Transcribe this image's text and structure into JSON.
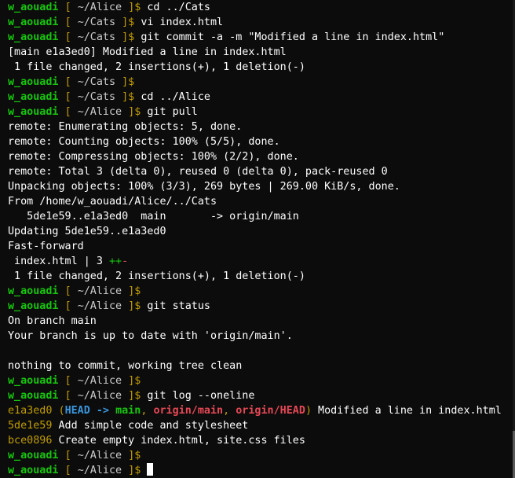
{
  "prompt": {
    "user": "w_aouadi",
    "open_bracket": "[",
    "close_bracket": "]$"
  },
  "lines": [
    {
      "type": "prompt",
      "dir": "~/Alice",
      "cmd": "cd ../Cats"
    },
    {
      "type": "prompt",
      "dir": "~/Cats",
      "cmd": "vi index.html"
    },
    {
      "type": "prompt",
      "dir": "~/Cats",
      "cmd": "git commit -a -m \"Modified a line in index.html\""
    },
    {
      "type": "output",
      "text": "[main e1a3ed0] Modified a line in index.html"
    },
    {
      "type": "output",
      "text": " 1 file changed, 2 insertions(+), 1 deletion(-)"
    },
    {
      "type": "prompt",
      "dir": "~/Cats",
      "cmd": ""
    },
    {
      "type": "prompt",
      "dir": "~/Cats",
      "cmd": "cd ../Alice"
    },
    {
      "type": "prompt",
      "dir": "~/Alice",
      "cmd": "git pull"
    },
    {
      "type": "output",
      "text": "remote: Enumerating objects: 5, done."
    },
    {
      "type": "output",
      "text": "remote: Counting objects: 100% (5/5), done."
    },
    {
      "type": "output",
      "text": "remote: Compressing objects: 100% (2/2), done."
    },
    {
      "type": "output",
      "text": "remote: Total 3 (delta 0), reused 0 (delta 0), pack-reused 0"
    },
    {
      "type": "output",
      "text": "Unpacking objects: 100% (3/3), 269 bytes | 269.00 KiB/s, done."
    },
    {
      "type": "output",
      "text": "From /home/w_aouadi/Alice/../Cats"
    },
    {
      "type": "output",
      "text": "   5de1e59..e1a3ed0  main       -> origin/main"
    },
    {
      "type": "output",
      "text": "Updating 5de1e59..e1a3ed0"
    },
    {
      "type": "output",
      "text": "Fast-forward"
    },
    {
      "type": "diffstat",
      "text": " index.html | 3 ",
      "plus": "++",
      "minus": "-"
    },
    {
      "type": "output",
      "text": " 1 file changed, 2 insertions(+), 1 deletion(-)"
    },
    {
      "type": "prompt",
      "dir": "~/Alice",
      "cmd": ""
    },
    {
      "type": "prompt",
      "dir": "~/Alice",
      "cmd": "git status"
    },
    {
      "type": "output",
      "text": "On branch main"
    },
    {
      "type": "output",
      "text": "Your branch is up to date with 'origin/main'."
    },
    {
      "type": "output",
      "text": ""
    },
    {
      "type": "output",
      "text": "nothing to commit, working tree clean"
    },
    {
      "type": "prompt",
      "dir": "~/Alice",
      "cmd": ""
    },
    {
      "type": "prompt",
      "dir": "~/Alice",
      "cmd": "git log --oneline"
    },
    {
      "type": "log",
      "hash": "e1a3ed0",
      "decorated": true,
      "msg": " Modified a line in index.html"
    },
    {
      "type": "log",
      "hash": "5de1e59",
      "decorated": false,
      "msg": " Add simple code and stylesheet"
    },
    {
      "type": "log",
      "hash": "bce0896",
      "decorated": false,
      "msg": " Create empty index.html, site.css files"
    },
    {
      "type": "prompt",
      "dir": "~/Alice",
      "cmd": ""
    },
    {
      "type": "prompt",
      "dir": "~/Alice",
      "cmd": "",
      "cursor": true
    }
  ],
  "decoration": {
    "open": "(",
    "head": "HEAD",
    "arrow": " -> ",
    "branch": "main",
    "sep": ", ",
    "remote_main": "origin/main",
    "remote_head": "origin/HEAD",
    "close": ")"
  },
  "colors": {
    "background": "#0c0c0c",
    "prompt_user": "#16c60c",
    "bracket": "#c19c00",
    "commit_hash": "#c19c00",
    "head": "#3a96dd",
    "remote_branch": "#e74856",
    "insertion": "#16c60c",
    "deletion": "#e74856"
  }
}
